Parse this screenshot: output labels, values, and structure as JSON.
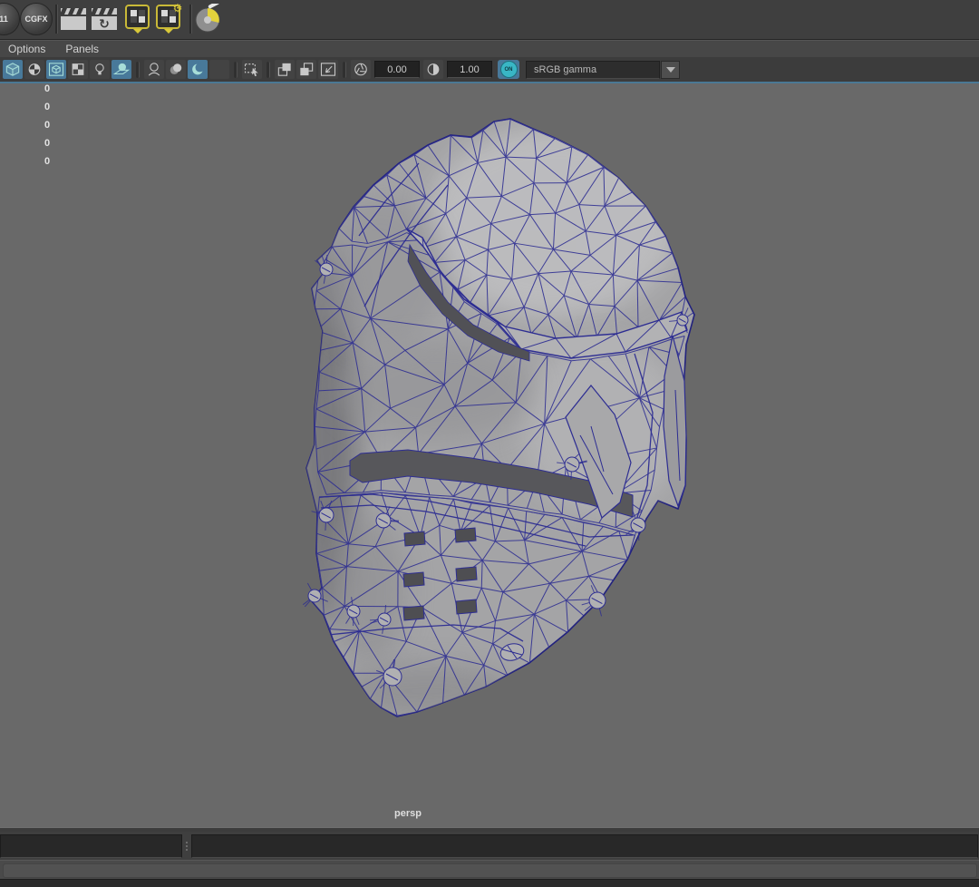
{
  "shelf": {
    "buttons": [
      {
        "name": "shelf-item-11",
        "label": "11"
      },
      {
        "name": "shelf-item-cgfx",
        "label": "CGFX"
      }
    ],
    "icons": [
      {
        "name": "playblast-icon"
      },
      {
        "name": "playblast-refresh-icon"
      },
      {
        "name": "render-checker-icon"
      },
      {
        "name": "render-settings-icon"
      },
      {
        "name": "paint-effects-icon"
      }
    ]
  },
  "panel_menu": {
    "items": [
      "Options",
      "Panels"
    ]
  },
  "viewport_toolbar": {
    "icons": [
      {
        "name": "shaded-display-icon",
        "glyph": "cube",
        "selected": true
      },
      {
        "name": "default-material-icon",
        "glyph": "sphereChecker",
        "selected": false
      },
      {
        "name": "textured-display-icon",
        "glyph": "cubeFrame",
        "selected": true
      },
      {
        "name": "use-default-material-icon",
        "glyph": "checker",
        "selected": false
      },
      {
        "name": "lighting-icon",
        "glyph": "bulb",
        "selected": false
      },
      {
        "name": "shadows-icon",
        "glyph": "spherePlane",
        "selected": true
      },
      {
        "name": "separator",
        "glyph": "sep",
        "selected": false
      },
      {
        "name": "image-plane-icon",
        "glyph": "spherePedestal",
        "selected": false
      },
      {
        "name": "smooth-shade-icon",
        "glyph": "sphereGray",
        "selected": false
      },
      {
        "name": "ambient-occlusion-icon",
        "glyph": "crescent",
        "selected": true
      },
      {
        "name": "motion-blur-icon",
        "glyph": "plain",
        "selected": false
      },
      {
        "name": "separator",
        "glyph": "sep",
        "selected": false
      },
      {
        "name": "isolate-select-icon",
        "glyph": "marquee",
        "selected": false
      },
      {
        "name": "separator",
        "glyph": "sep",
        "selected": false
      },
      {
        "name": "copy-layer-icon",
        "glyph": "copyFront",
        "selected": false
      },
      {
        "name": "paste-layer-icon",
        "glyph": "copyBack",
        "selected": false
      },
      {
        "name": "pan-zoom-icon",
        "glyph": "diagArrow",
        "selected": false
      },
      {
        "name": "separator",
        "glyph": "sep",
        "selected": false
      },
      {
        "name": "exposure-icon",
        "glyph": "aperture",
        "selected": false
      }
    ],
    "exposure_value": "0.00",
    "gamma_value": "1.00",
    "toggle_label": "ON",
    "colorspace": "sRGB gamma"
  },
  "viewport": {
    "hud_counts": [
      "0",
      "0",
      "0",
      "0",
      "0"
    ],
    "camera_label": "persp"
  },
  "colors": {
    "accent_blue": "#48799a",
    "selected_teal": "#8fd8d2",
    "wireframe_blue": "#2d2d92",
    "viewport_background": "#696969",
    "helmet_gray": "#a6a6a8",
    "shelf_yellow": "#d9c93a"
  }
}
